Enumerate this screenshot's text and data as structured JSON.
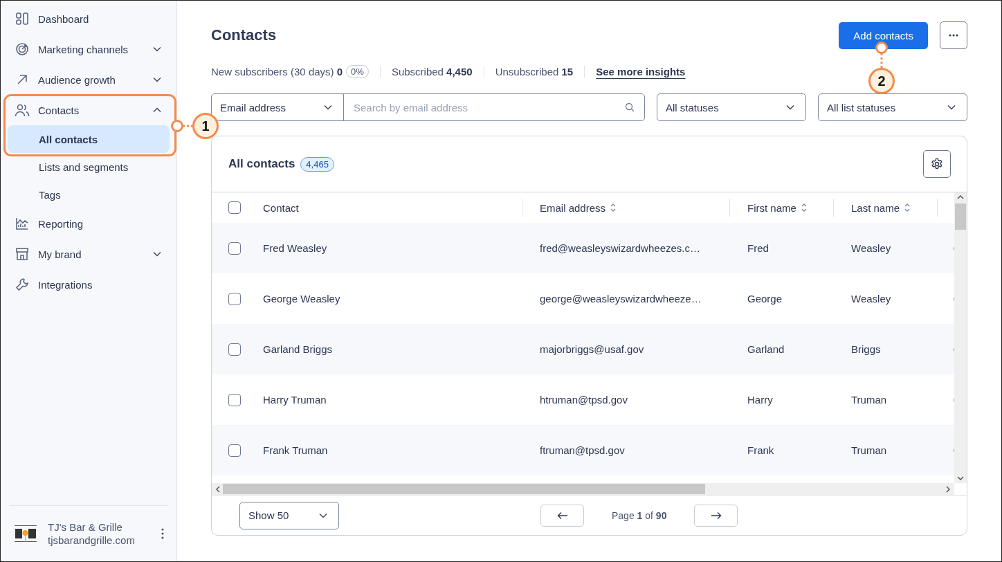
{
  "sidebar": {
    "items": [
      {
        "label": "Dashboard",
        "kind": "link"
      },
      {
        "label": "Marketing channels",
        "kind": "group",
        "expanded": false
      },
      {
        "label": "Audience growth",
        "kind": "group",
        "expanded": false
      },
      {
        "label": "Contacts",
        "kind": "group",
        "expanded": true,
        "children": [
          {
            "label": "All contacts",
            "selected": true
          },
          {
            "label": "Lists and segments",
            "selected": false
          },
          {
            "label": "Tags",
            "selected": false
          }
        ]
      },
      {
        "label": "Reporting",
        "kind": "link"
      },
      {
        "label": "My brand",
        "kind": "group",
        "expanded": false
      },
      {
        "label": "Integrations",
        "kind": "link"
      }
    ],
    "account": {
      "name": "TJ's Bar & Grille",
      "domain": "tjsbarandgrille.com"
    }
  },
  "page": {
    "title": "Contacts",
    "primary_button": "Add contacts"
  },
  "stats": [
    {
      "text": "New subscribers (30 days) **0**",
      "badge": "0%"
    },
    {
      "text": "Subscribed **4,450**"
    },
    {
      "text": "Unsubscribed **15**"
    }
  ],
  "insights_link": "See more insights",
  "filters": {
    "field_select": "Email address",
    "search": {
      "placeholder": "Search by email address"
    },
    "status": "All statuses",
    "list_status": "All list statuses"
  },
  "table": {
    "title": "All contacts",
    "count": "4,465",
    "all_selected": false,
    "columns": [
      {
        "label": "Contact",
        "kind": "plain"
      },
      {
        "label": "Email address",
        "kind": "sortable"
      },
      {
        "label": "First name",
        "kind": "sortable"
      },
      {
        "label": "Last name",
        "kind": "sortable"
      }
    ],
    "rows": [
      {
        "selected": false,
        "contact": "Fred Weasley",
        "email": "fred@weasleyswizardwheezes.c…",
        "first": "Fred",
        "last": "Weasley"
      },
      {
        "selected": false,
        "contact": "George Weasley",
        "email": "george@weasleyswizardwheeze…",
        "first": "George",
        "last": "Weasley"
      },
      {
        "selected": false,
        "contact": "Garland Briggs",
        "email": "majorbriggs@usaf.gov",
        "first": "Garland",
        "last": "Briggs"
      },
      {
        "selected": false,
        "contact": "Harry Truman",
        "email": "htruman@tpsd.gov",
        "first": "Harry",
        "last": "Truman"
      },
      {
        "selected": false,
        "contact": "Frank Truman",
        "email": "ftruman@tpsd.gov",
        "first": "Frank",
        "last": "Truman"
      }
    ]
  },
  "pagination": {
    "page_size": "Show 50",
    "page_text": "Page **1** of **90**"
  },
  "callouts": [
    {
      "number": "1"
    },
    {
      "number": "2"
    }
  ]
}
